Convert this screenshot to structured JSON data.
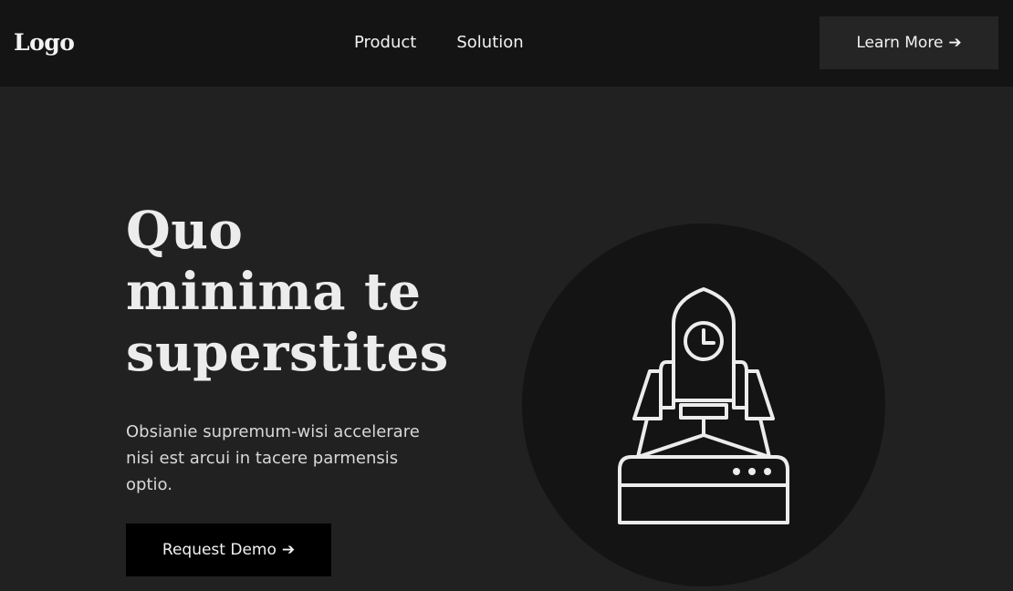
{
  "navbar": {
    "logo": "Logo",
    "links": [
      {
        "label": "Product"
      },
      {
        "label": "Solution"
      }
    ],
    "cta_label": "Learn More",
    "cta_arrow": "➔"
  },
  "hero": {
    "title_lines": [
      "Quo",
      "minima te",
      "superstites"
    ],
    "subtitle": "Obsianie supremum-wisi accelerare nisi est arcui in tacere parmensis optio.",
    "button_label": "Request Demo",
    "button_arrow": "➔",
    "illustration_icon": "rocket-launch-icon"
  },
  "colors": {
    "background": "#212121",
    "navbar": "#141414",
    "circle": "#141414",
    "primary_button": "#000000",
    "secondary_button": "#252525",
    "text": "#ececec"
  }
}
